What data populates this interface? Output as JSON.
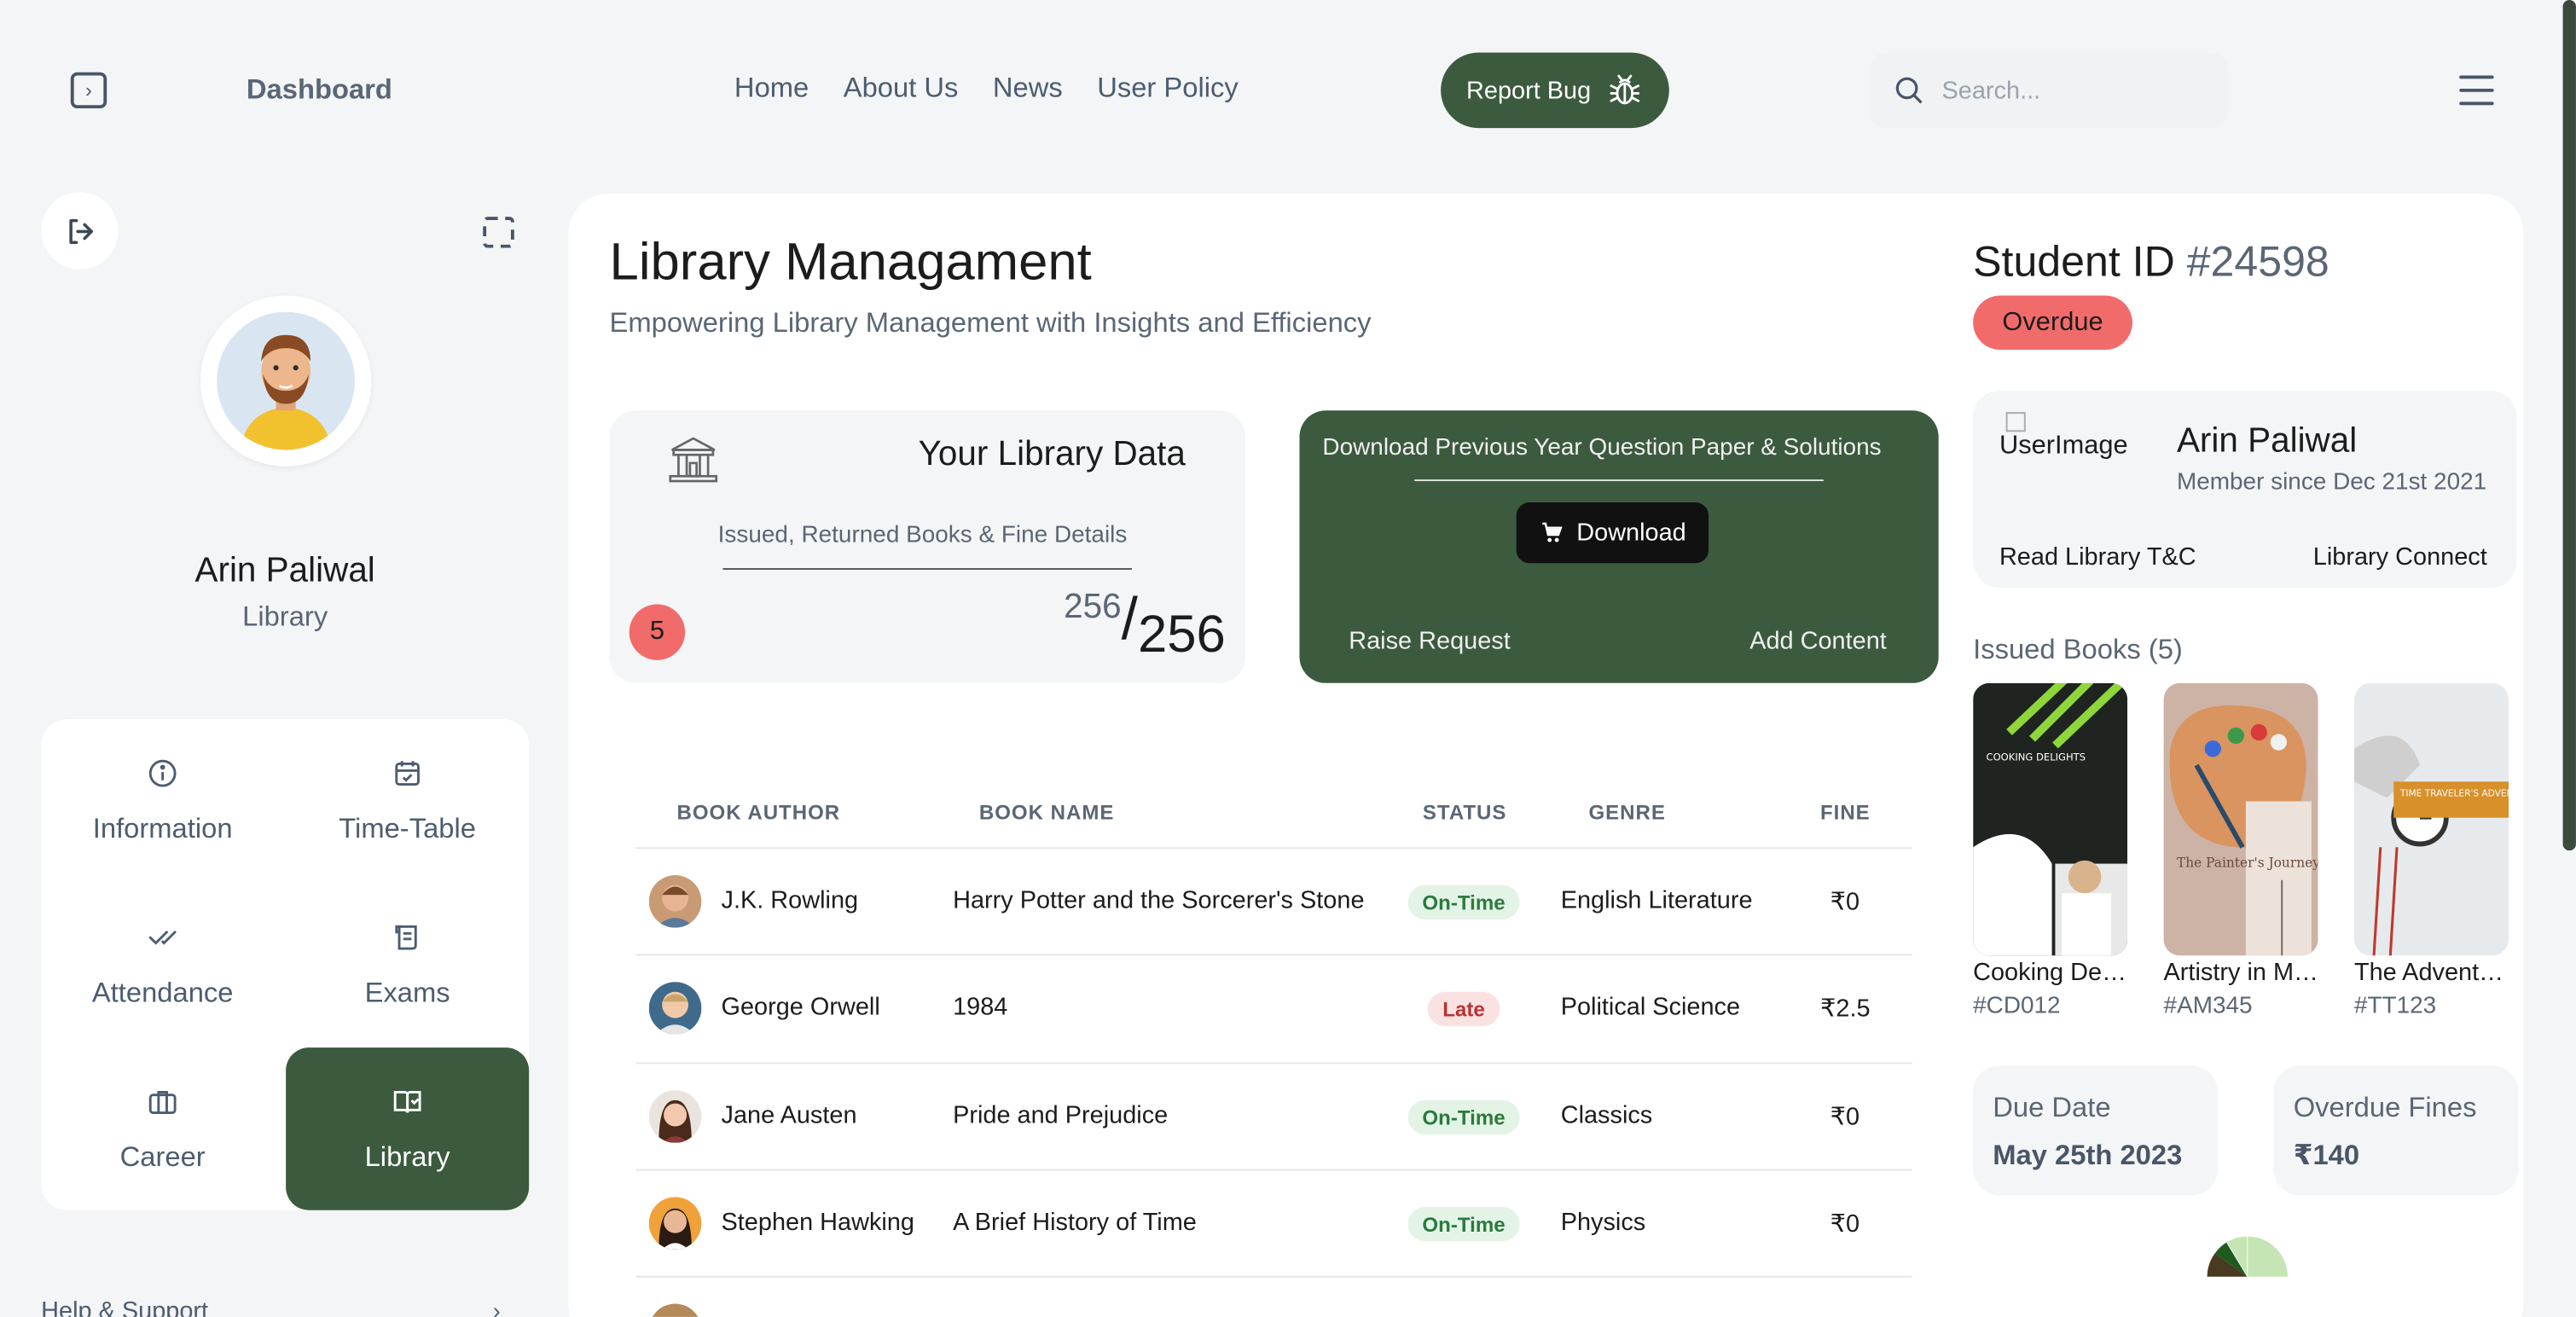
{
  "header": {
    "brand": "Dashboard",
    "nav": [
      "Home",
      "About Us",
      "News",
      "User Policy"
    ],
    "report_bug": "Report Bug",
    "search_placeholder": "Search..."
  },
  "sidebar": {
    "user_name": "Arin Paliwal",
    "user_role": "Library",
    "menu": [
      {
        "label": "Information",
        "icon": "info-icon"
      },
      {
        "label": "Time-Table",
        "icon": "calendar-icon"
      },
      {
        "label": "Attendance",
        "icon": "double-check-icon"
      },
      {
        "label": "Exams",
        "icon": "exam-icon"
      },
      {
        "label": "Career",
        "icon": "briefcase-icon"
      },
      {
        "label": "Library",
        "icon": "book-icon",
        "active": true
      }
    ],
    "help": "Help & Support"
  },
  "main": {
    "title": "Library Managament",
    "subtitle": "Empowering Library Management with Insights and Efficiency",
    "library_card": {
      "title": "Your Library Data",
      "subtitle": "Issued, Returned Books & Fine Details",
      "badge": "5",
      "count_small": "256",
      "slash": "/",
      "count_big": "256"
    },
    "download_card": {
      "title": "Download Previous Year Question Paper & Solutions",
      "button": "Download",
      "raise": "Raise Request",
      "add": "Add Content"
    },
    "table": {
      "headers": [
        "BOOK AUTHOR",
        "BOOK NAME",
        "STATUS",
        "GENRE",
        "FINE"
      ],
      "rows": [
        {
          "author": "J.K. Rowling",
          "book": "Harry Potter and the Sorcerer's Stone",
          "status": "On-Time",
          "genre": "English Literature",
          "fine": "₹0"
        },
        {
          "author": "George Orwell",
          "book": "1984",
          "status": "Late",
          "genre": "Political Science",
          "fine": "₹2.5"
        },
        {
          "author": "Jane Austen",
          "book": "Pride and Prejudice",
          "status": "On-Time",
          "genre": "Classics",
          "fine": "₹0"
        },
        {
          "author": "Stephen Hawking",
          "book": "A Brief History of Time",
          "status": "On-Time",
          "genre": "Physics",
          "fine": "₹0"
        }
      ]
    }
  },
  "right": {
    "student_label": "Student ID",
    "student_id": "#24598",
    "status_pill": "Overdue",
    "image_alt": "UserImage",
    "member_name": "Arin Paliwal",
    "member_since": "Member since Dec 21st 2021",
    "tc_link": "Read Library T&C",
    "connect_link": "Library Connect",
    "issued_title": "Issued Books (5)",
    "books": [
      {
        "title": "Cooking Delights",
        "code": "#CD012",
        "cover_text": "COOKING DELIGHTS"
      },
      {
        "title": "Artistry in Motion",
        "code": "#AM345",
        "cover_text": "The Painter's Journey"
      },
      {
        "title": "The Adventure",
        "code": "#TT123",
        "cover_text": "TIME TRAVELER'S ADVENTURE"
      }
    ],
    "due_label": "Due Date",
    "due_value": "May 25th 2023",
    "fines_label": "Overdue Fines",
    "fines_value": "₹140"
  },
  "colors": {
    "accent_green": "#3b5a3e",
    "alert_red": "#f26b6b",
    "panel_bg": "#ffffff",
    "page_bg": "#f3f5f6"
  }
}
